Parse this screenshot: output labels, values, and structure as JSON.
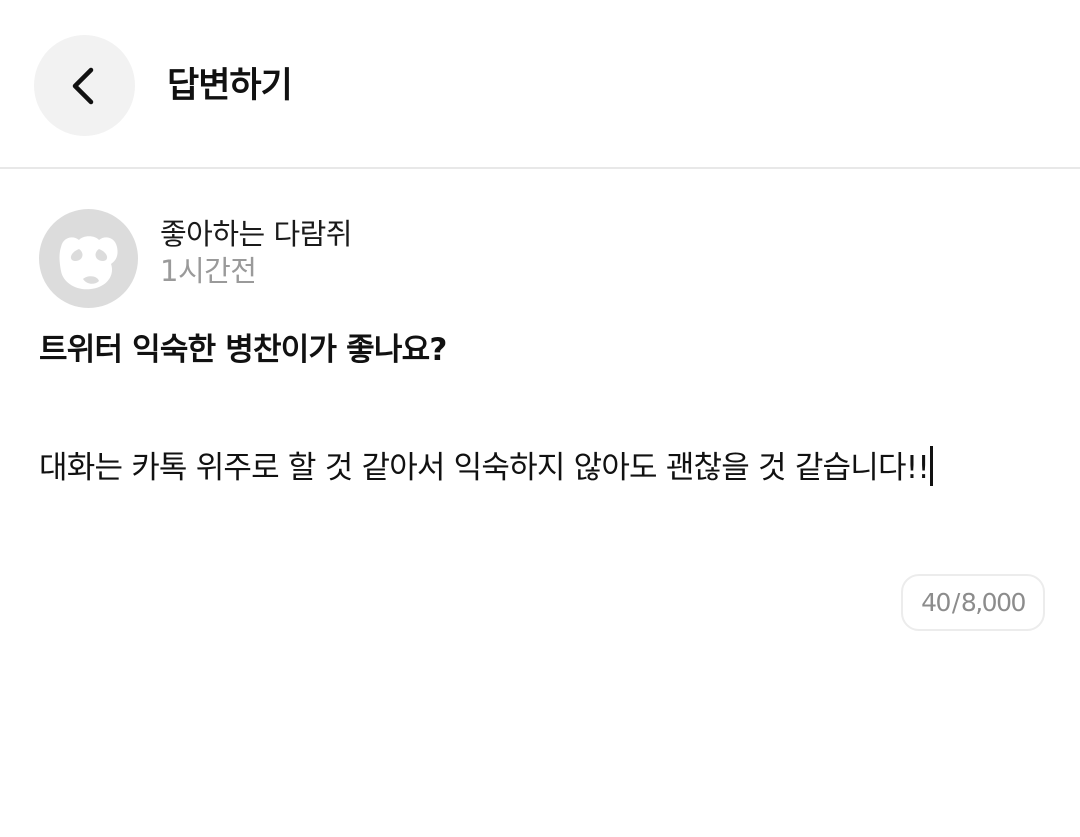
{
  "header": {
    "back_icon": "chevron-left-icon",
    "title": "답변하기"
  },
  "post": {
    "avatar_icon": "raccoon-avatar-icon",
    "author": "좋아하는 다람쥐",
    "time": "1시간전",
    "question": "트위터 익숙한 병찬이가 좋나요?"
  },
  "answer": {
    "text": "대화는 카톡 위주로 할 것 같아서 익숙하지 않아도 괜찮을 것 같습니다!!"
  },
  "counter": {
    "current": "40",
    "separator": "/",
    "max": "8,000"
  },
  "colors": {
    "background": "#ffffff",
    "back_button_bg": "#f2f2f2",
    "avatar_bg": "#dcdcdc",
    "muted_text": "#9a9a9a",
    "divider": "#e8e8e8"
  }
}
